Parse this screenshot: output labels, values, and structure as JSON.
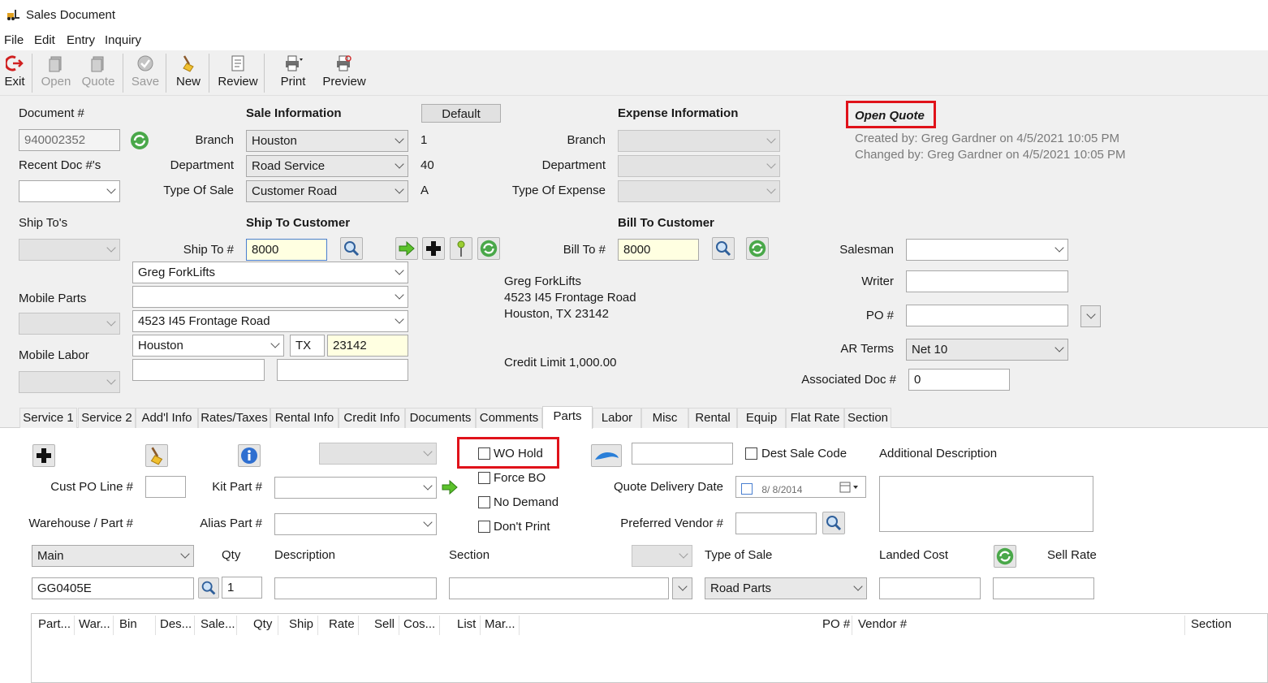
{
  "window": {
    "title": "Sales Document",
    "app_icon": "forklift-icon"
  },
  "menu": {
    "items": [
      "File",
      "Edit",
      "Entry",
      "Inquiry"
    ]
  },
  "toolbar": {
    "exit": "Exit",
    "open": "Open",
    "quote": "Quote",
    "save": "Save",
    "new": "New",
    "review": "Review",
    "print": "Print",
    "preview": "Preview"
  },
  "header": {
    "document_label": "Document #",
    "document_value": "940002352",
    "recent_docs_label": "Recent Doc #'s",
    "ship_tos_label": "Ship To's",
    "mobile_parts_label": "Mobile Parts",
    "mobile_labor_label": "Mobile Labor"
  },
  "sale_info": {
    "title": "Sale Information",
    "default_button": "Default",
    "branch_label": "Branch",
    "branch_value": "Houston",
    "branch_code": "1",
    "department_label": "Department",
    "department_value": "Road Service",
    "department_code": "40",
    "type_label": "Type Of Sale",
    "type_value": "Customer Road",
    "type_code": "A"
  },
  "expense_info": {
    "title": "Expense Information",
    "branch_label": "Branch",
    "department_label": "Department",
    "type_label": "Type Of Expense"
  },
  "status": {
    "title": "Open Quote",
    "created": "Created by: Greg Gardner on 4/5/2021 10:05 PM",
    "changed": "Changed by: Greg Gardner on 4/5/2021 10:05 PM"
  },
  "ship_to": {
    "title": "Ship To Customer",
    "ship_to_label": "Ship To #",
    "ship_to_value": "8000",
    "name": "Greg ForkLifts",
    "address2": "",
    "address1": "4523 I45 Frontage Road",
    "city": "Houston",
    "state": "TX",
    "zip": "23142"
  },
  "bill_to": {
    "title": "Bill To Customer",
    "bill_to_label": "Bill To #",
    "bill_to_value": "8000",
    "name": "Greg ForkLifts",
    "address": "4523 I45 Frontage Road",
    "city_line": "Houston, TX  23142",
    "credit_limit": "Credit Limit 1,000.00"
  },
  "right": {
    "salesman_label": "Salesman",
    "salesman_value": "",
    "writer_label": "Writer",
    "writer_value": "",
    "po_label": "PO #",
    "po_value": "",
    "ar_terms_label": "AR Terms",
    "ar_terms_value": "Net 10",
    "assoc_label": "Associated Doc #",
    "assoc_value": "0"
  },
  "tabs": [
    "Service 1",
    "Service 2",
    "Add'l Info",
    "Rates/Taxes",
    "Rental Info",
    "Credit Info",
    "Documents",
    "Comments",
    "Parts",
    "Labor",
    "Misc",
    "Rental",
    "Equip",
    "Flat Rate",
    "Section"
  ],
  "active_tab": "Parts",
  "parts": {
    "wo_hold": "WO Hold",
    "force_bo": "Force BO",
    "no_demand": "No Demand",
    "dont_print": "Don't Print",
    "dest_sale_code": "Dest Sale Code",
    "additional_description": "Additional Description",
    "cust_po_line_label": "Cust PO Line #",
    "kit_part_label": "Kit Part #",
    "quote_delivery_label": "Quote Delivery Date",
    "quote_delivery_value": "8/  8/2014",
    "warehouse_part_label": "Warehouse / Part #",
    "alias_part_label": "Alias Part #",
    "preferred_vendor_label": "Preferred Vendor #",
    "warehouse_value": "Main",
    "qty_label": "Qty",
    "description_label": "Description",
    "section_label": "Section",
    "type_of_sale_label": "Type of Sale",
    "landed_cost_label": "Landed Cost",
    "sell_rate_label": "Sell Rate",
    "part_value": "GG0405E",
    "qty_value": "1",
    "type_of_sale_value": "Road Parts"
  },
  "grid": {
    "columns": [
      "Part...",
      "War...",
      "Bin",
      "Des...",
      "Sale...",
      "Qty",
      "Ship",
      "Rate",
      "Sell",
      "Cos...",
      "List",
      "Mar...",
      "PO #",
      "Vendor #",
      "Section"
    ]
  }
}
